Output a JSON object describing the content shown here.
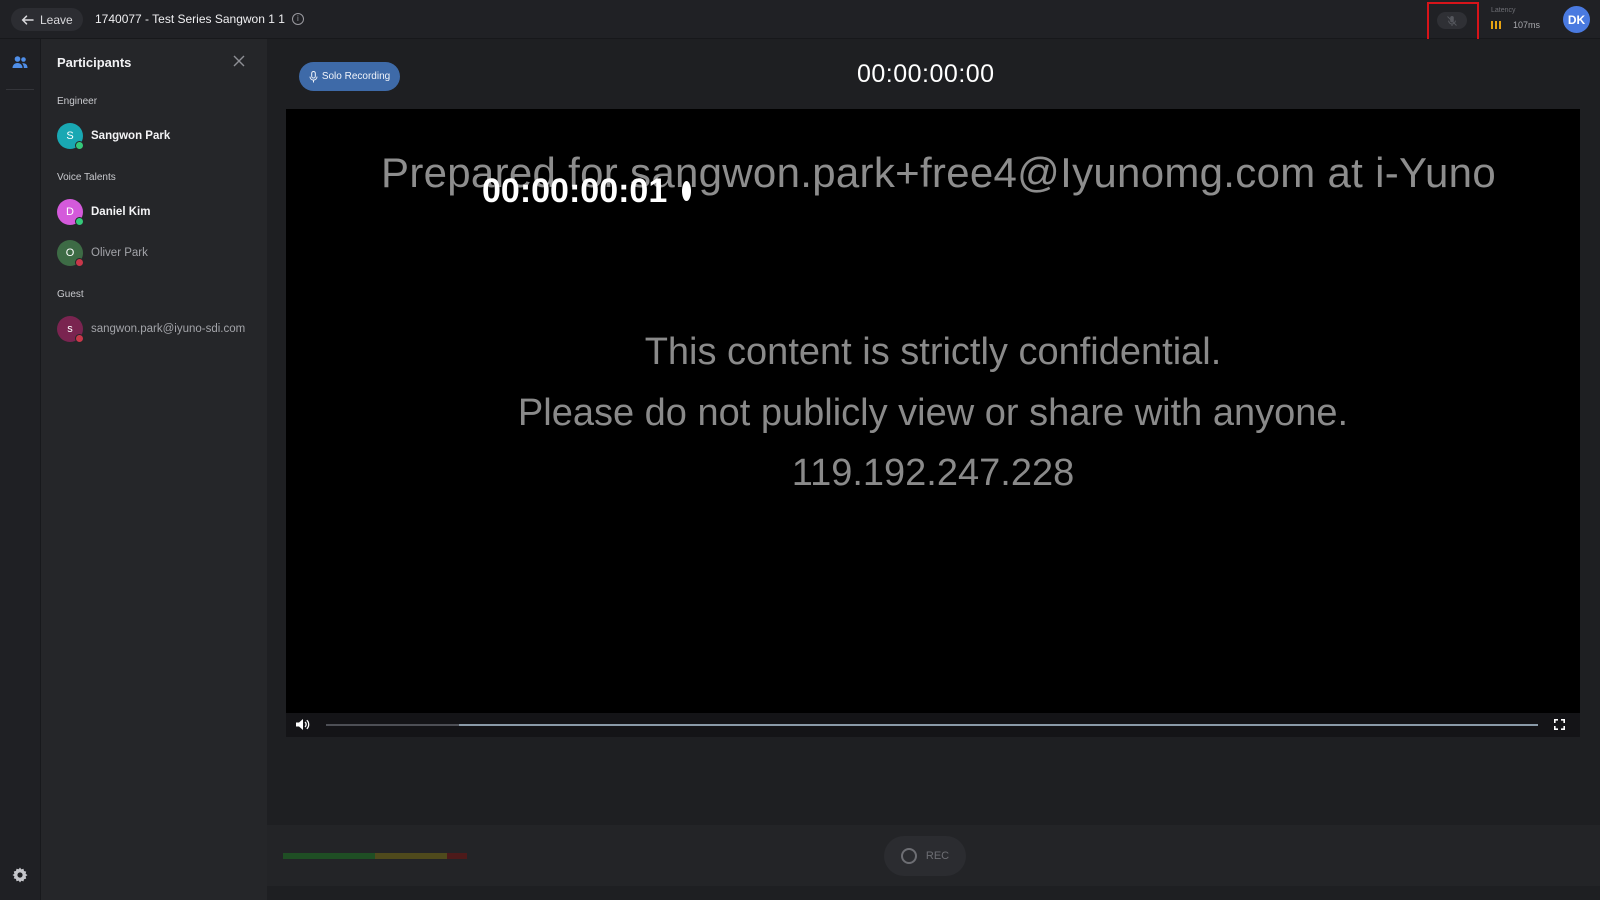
{
  "header": {
    "leave_label": "Leave",
    "session_title": "1740077 - Test Series Sangwon 1 1",
    "latency_label": "Latency",
    "latency_value": "107ms",
    "user_initials": "DK"
  },
  "participants": {
    "title": "Participants",
    "groups": [
      {
        "label": "Engineer",
        "members": [
          {
            "initial": "S",
            "name": "Sangwon Park",
            "status": "online",
            "avatar_color": "#19a8b3"
          }
        ]
      },
      {
        "label": "Voice Talents",
        "members": [
          {
            "initial": "D",
            "name": "Daniel Kim",
            "status": "online",
            "avatar_color": "#d45adb"
          },
          {
            "initial": "O",
            "name": "Oliver Park",
            "status": "offline",
            "avatar_color": "#3d6b45"
          }
        ]
      },
      {
        "label": "Guest",
        "members": [
          {
            "initial": "s",
            "name": "sangwon.park@iyuno-sdi.com",
            "status": "offline",
            "avatar_color": "#7a2450"
          }
        ]
      }
    ]
  },
  "main": {
    "solo_recording_label": "Solo Recording",
    "timecode": "00:00:00:00"
  },
  "video": {
    "watermark": "Prepared for sangwon.park+free4@Iyunomg.com at i-Yuno",
    "burnin_timecode": "00:00:00:01",
    "confidential_line1": "This content is strictly confidential.",
    "confidential_line2": "Please do not publicly view or share with anyone.",
    "ip_address": "119.192.247.228",
    "progress": 0.11
  },
  "recording": {
    "rec_label": "REC"
  },
  "colors": {
    "accent": "#3e6aa8",
    "online": "#35c97a",
    "offline": "#c8374a",
    "highlight_border": "#d7141a",
    "latency_bars": "#e7a312"
  }
}
